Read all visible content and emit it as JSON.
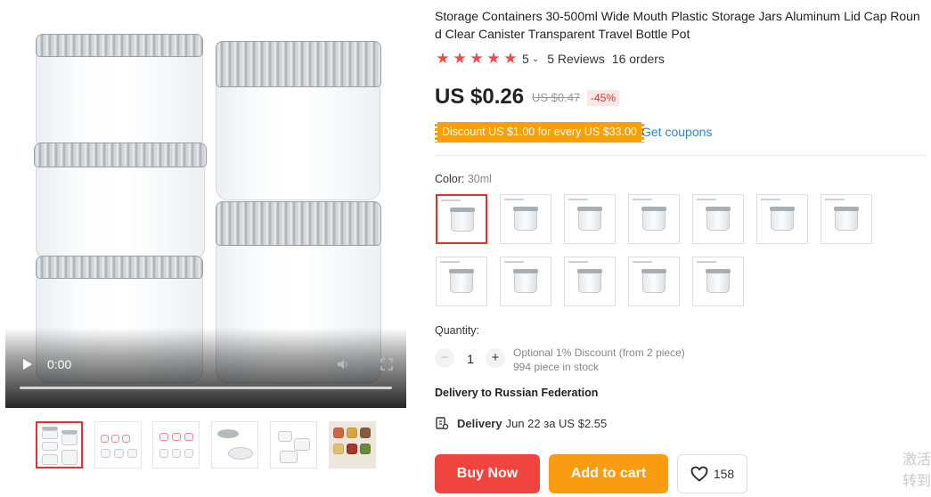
{
  "video": {
    "time": "0:00"
  },
  "product": {
    "title": "Storage Containers 30-500ml Wide Mouth Plastic Storage Jars Aluminum Lid Cap Round Clear Canister Transparent Travel Bottle Pot",
    "rating": {
      "stars": 5,
      "score": "5",
      "reviews": "5 Reviews",
      "orders": "16 orders"
    },
    "price": "US $0.26",
    "old_price": "US $0.47",
    "discount": "-45%",
    "coupon": "Discount US $1.00 for every US $33.00",
    "get_coupons": "Get coupons"
  },
  "color": {
    "label": "Color: ",
    "value": "30ml",
    "option_count": 12,
    "selected_index": 0
  },
  "quantity": {
    "label": "Quantity:",
    "minus": "−",
    "value": "1",
    "plus": "+",
    "optional_discount": "Optional 1% Discount (from 2 piece)",
    "stock": "994 piece in stock"
  },
  "delivery": {
    "to": "Delivery to Russian Federation",
    "label": "Delivery",
    "detail": "Jun 22 за US $2.55"
  },
  "actions": {
    "buy_now": "Buy Now",
    "add_to_cart": "Add to cart",
    "wishlist_count": "158"
  },
  "watermark": "激活\n转到"
}
